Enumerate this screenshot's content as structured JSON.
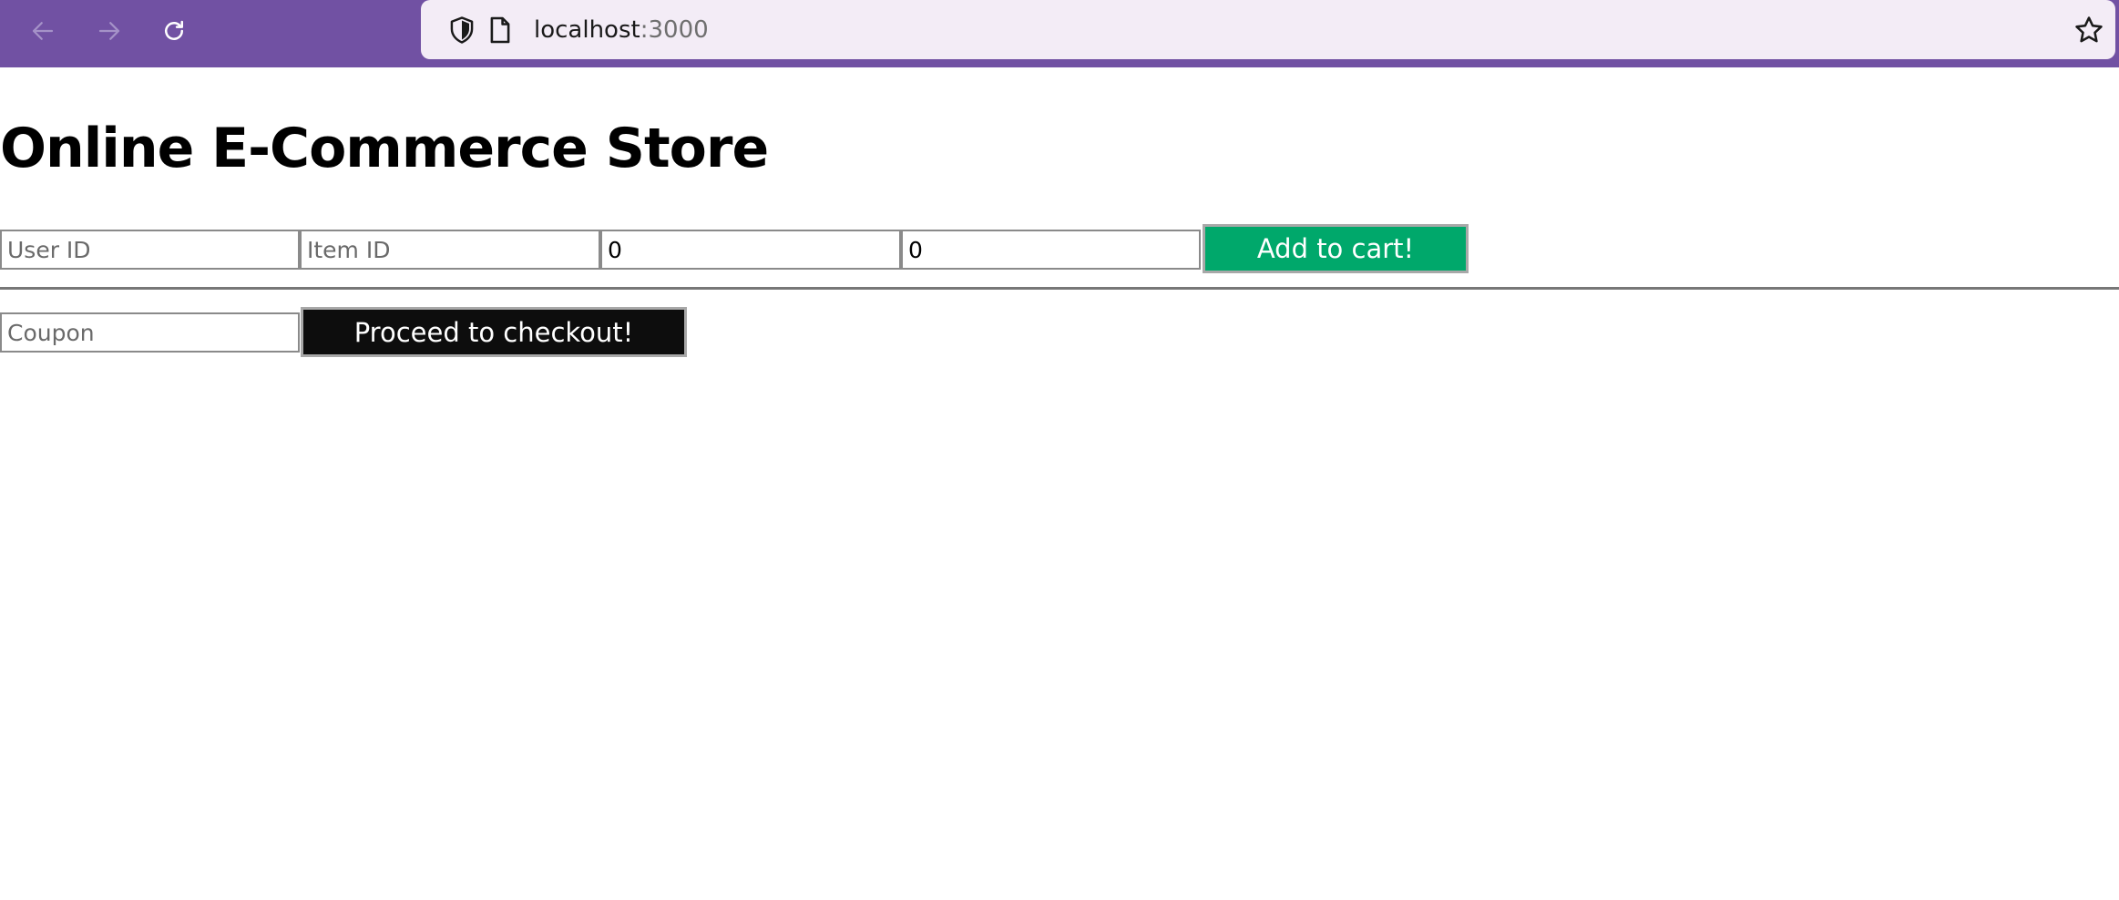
{
  "browser": {
    "url_host": "localhost",
    "url_port": ":3000",
    "icons": {
      "back": "arrow-left-icon",
      "forward": "arrow-right-icon",
      "reload": "reload-icon",
      "shield": "shield-icon",
      "page": "page-icon",
      "bookmark": "star-icon"
    },
    "colors": {
      "toolbar": "#7151a3",
      "url_bar": "#f3ecf6"
    }
  },
  "page": {
    "title": "Online E-Commerce Store"
  },
  "cart_form": {
    "user_id_placeholder": "User ID",
    "item_id_placeholder": "Item ID",
    "quantity_value": "0",
    "price_value": "0",
    "add_button_label": "Add to cart!",
    "add_button_color": "#00a86b"
  },
  "checkout_form": {
    "coupon_placeholder": "Coupon",
    "checkout_button_label": "Proceed to checkout!",
    "checkout_button_color": "#0d0d0d"
  }
}
